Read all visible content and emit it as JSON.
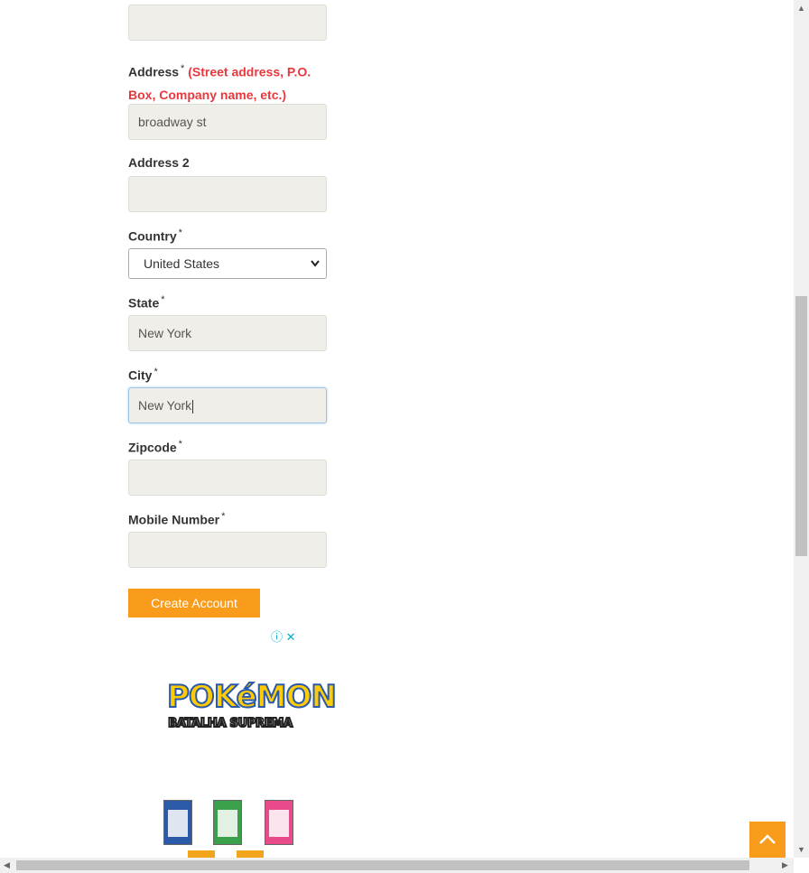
{
  "form": {
    "address": {
      "label": "Address",
      "required": "*",
      "hint": "(Street address, P.O. Box, Company name, etc.)",
      "value": "broadway st"
    },
    "address2": {
      "label": "Address 2",
      "value": ""
    },
    "country": {
      "label": "Country",
      "required": "*",
      "selected": "United States"
    },
    "state": {
      "label": "State",
      "required": "*",
      "value": "New York"
    },
    "city": {
      "label": "City",
      "required": "*",
      "value": "New York"
    },
    "zipcode": {
      "label": "Zipcode",
      "required": "*",
      "value": ""
    },
    "mobile": {
      "label": "Mobile Number",
      "required": "*",
      "value": ""
    },
    "submit_label": "Create Account"
  },
  "ad": {
    "close_icons": "ⓘ ✕",
    "brand": "POKéMON",
    "subtitle": "BATALHA SUPREMA",
    "colors": [
      "#2a5aa8",
      "#3aa14a",
      "#e84a8a",
      "#f2a51c"
    ]
  },
  "ui": {
    "accent": "#f99c1c",
    "scroll_to_top_icon": "chevron-up-icon"
  }
}
